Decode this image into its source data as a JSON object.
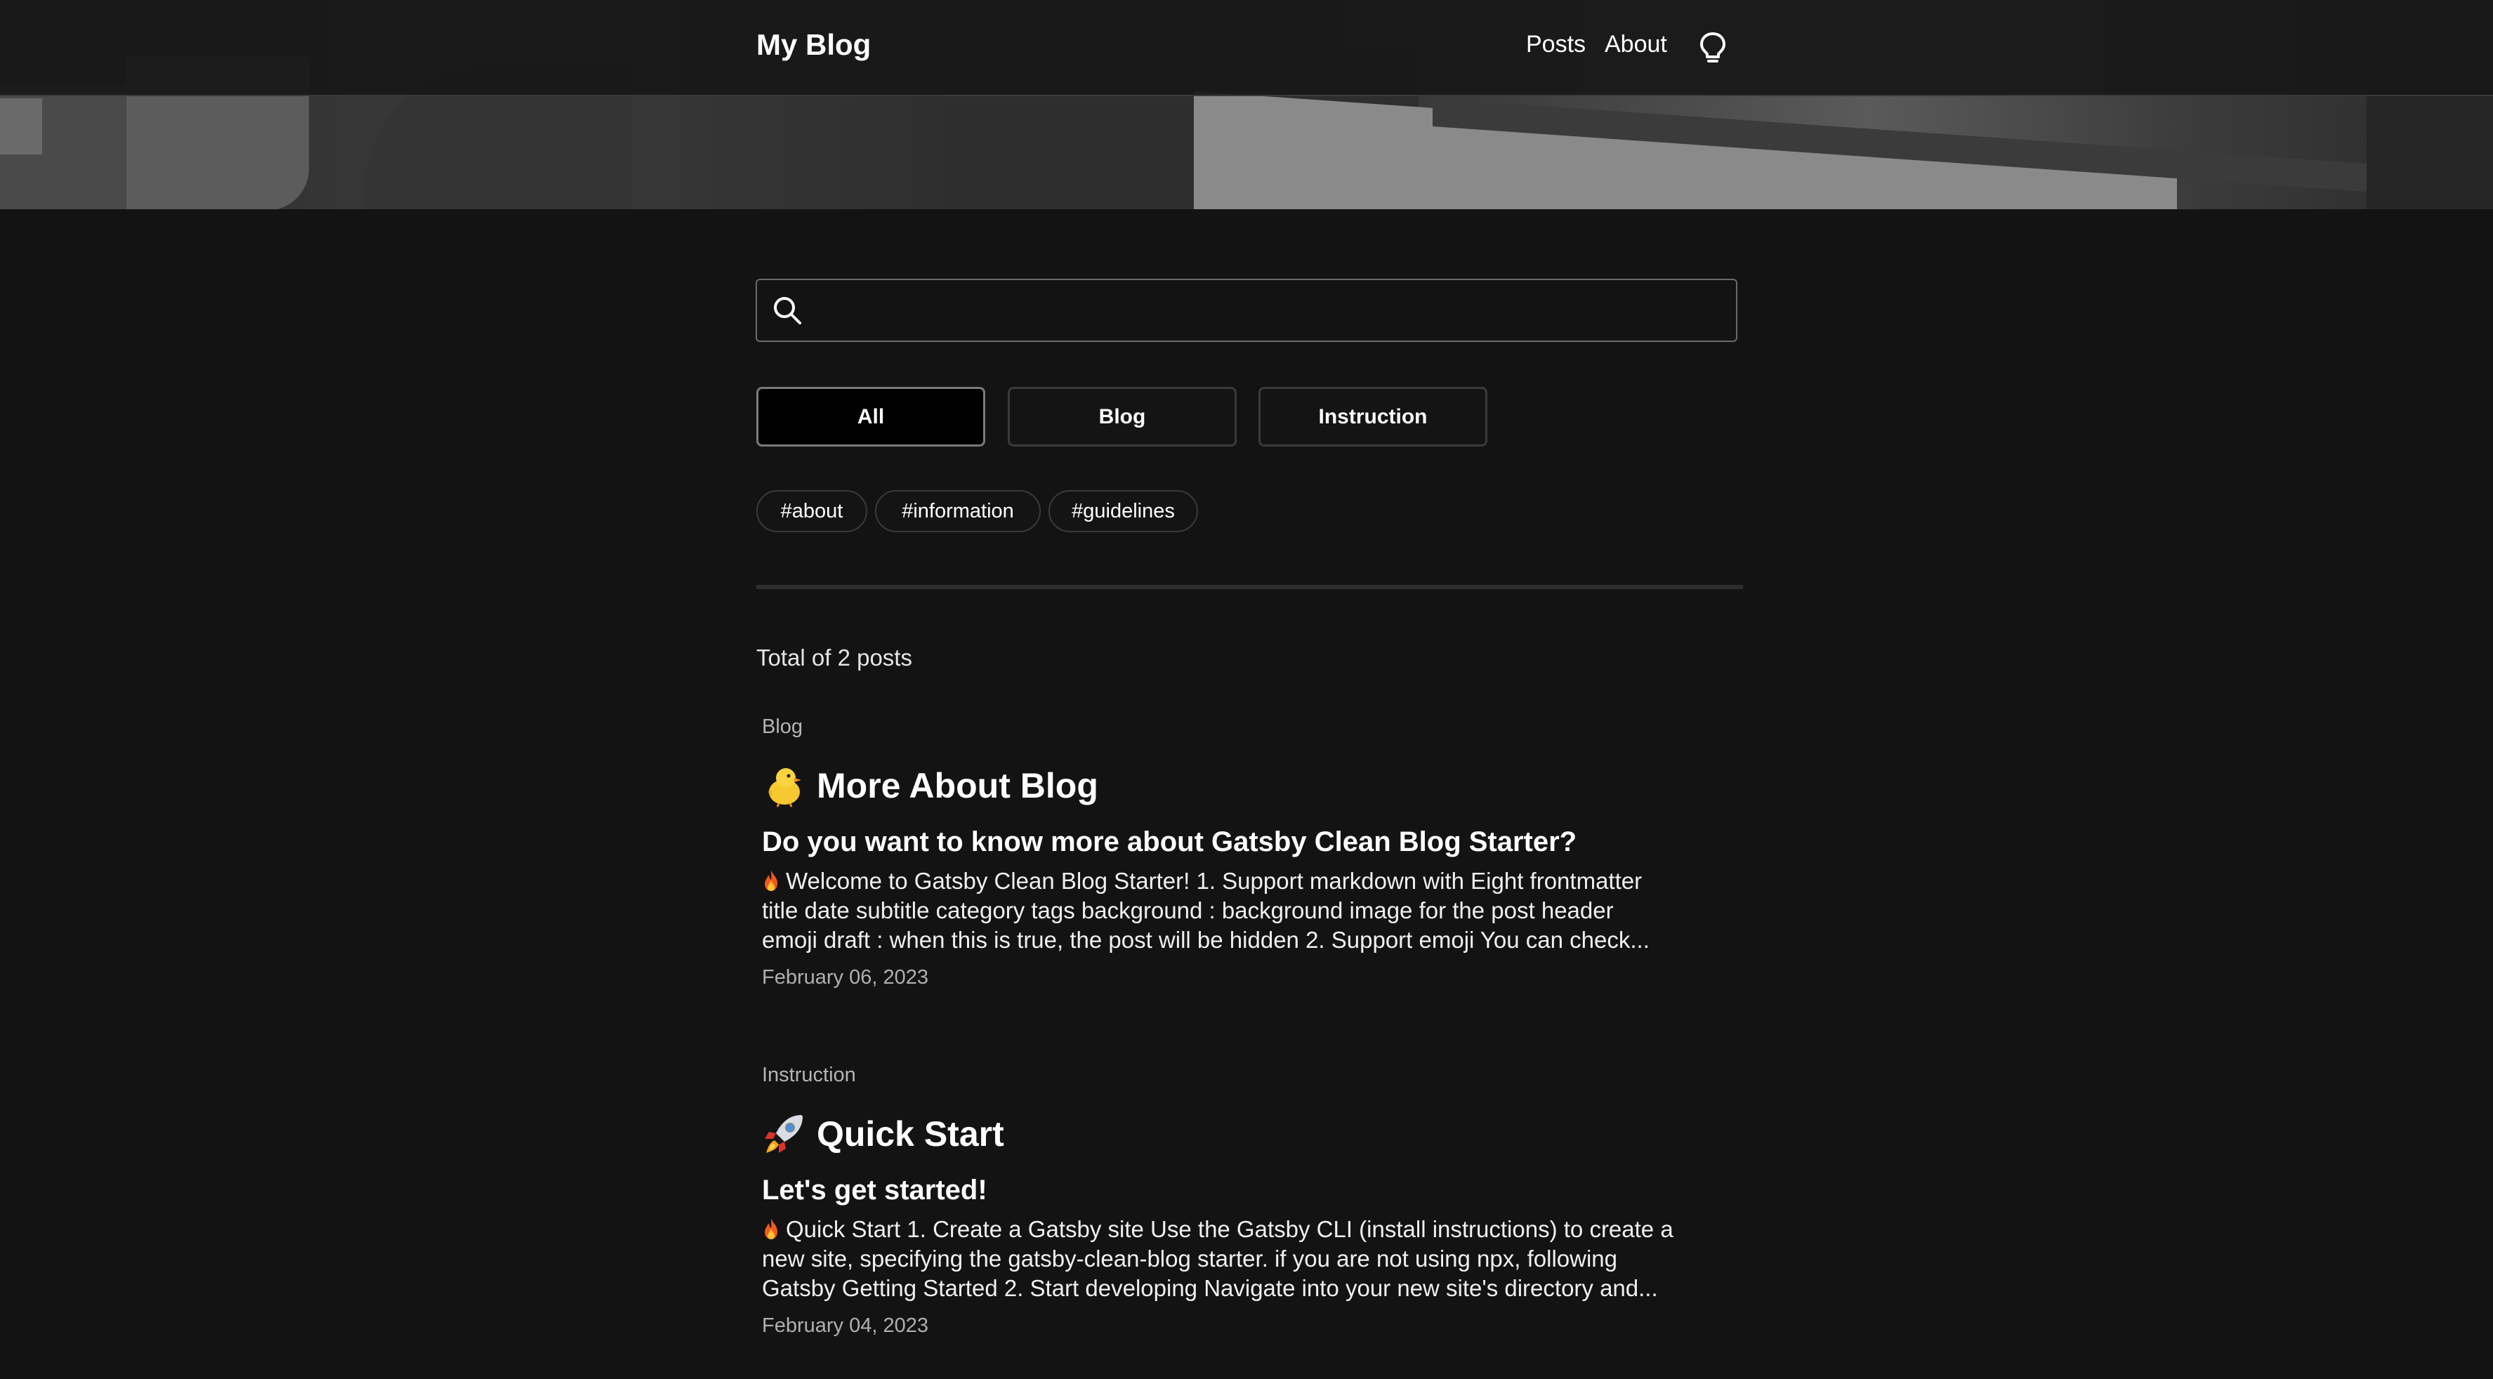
{
  "header": {
    "site_title": "My Blog",
    "nav": [
      {
        "label": "Posts"
      },
      {
        "label": "About"
      }
    ],
    "theme_toggle_icon": "lightbulb-icon"
  },
  "search": {
    "value": "",
    "placeholder": "",
    "icon": "search-icon"
  },
  "categories": [
    {
      "label": "All",
      "active": true
    },
    {
      "label": "Blog",
      "active": false
    },
    {
      "label": "Instruction",
      "active": false
    }
  ],
  "tags": [
    "#about",
    "#information",
    "#guidelines"
  ],
  "total_text": "Total of 2 posts",
  "posts": [
    {
      "category": "Blog",
      "emoji": "chick-icon",
      "title": "More About Blog",
      "subtitle": "Do you want to know more about Gatsby Clean Blog Starter?",
      "excerpt": "Welcome to Gatsby Clean Blog Starter!   1. Support markdown with Eight frontmatter title date subtitle category tags background : background image for the post header emoji draft : when this is true, the post will be hidden 2. Support emoji You can check...",
      "date": "February 06, 2023"
    },
    {
      "category": "Instruction",
      "emoji": "rocket-icon",
      "title": "Quick Start",
      "subtitle": "Let's get started!",
      "excerpt": "Quick Start 1. Create a Gatsby site Use the Gatsby CLI (install instructions) to create a new site, specifying the gatsby-clean-blog starter. if you are not using npx, following Gatsby Getting Started 2. Start developing Navigate into your new site's directory and...",
      "date": "February 04, 2023"
    }
  ],
  "colors": {
    "background": "#131313",
    "text": "#ffffff",
    "muted": "#b5b5b5",
    "border": "#3a3a3a"
  }
}
